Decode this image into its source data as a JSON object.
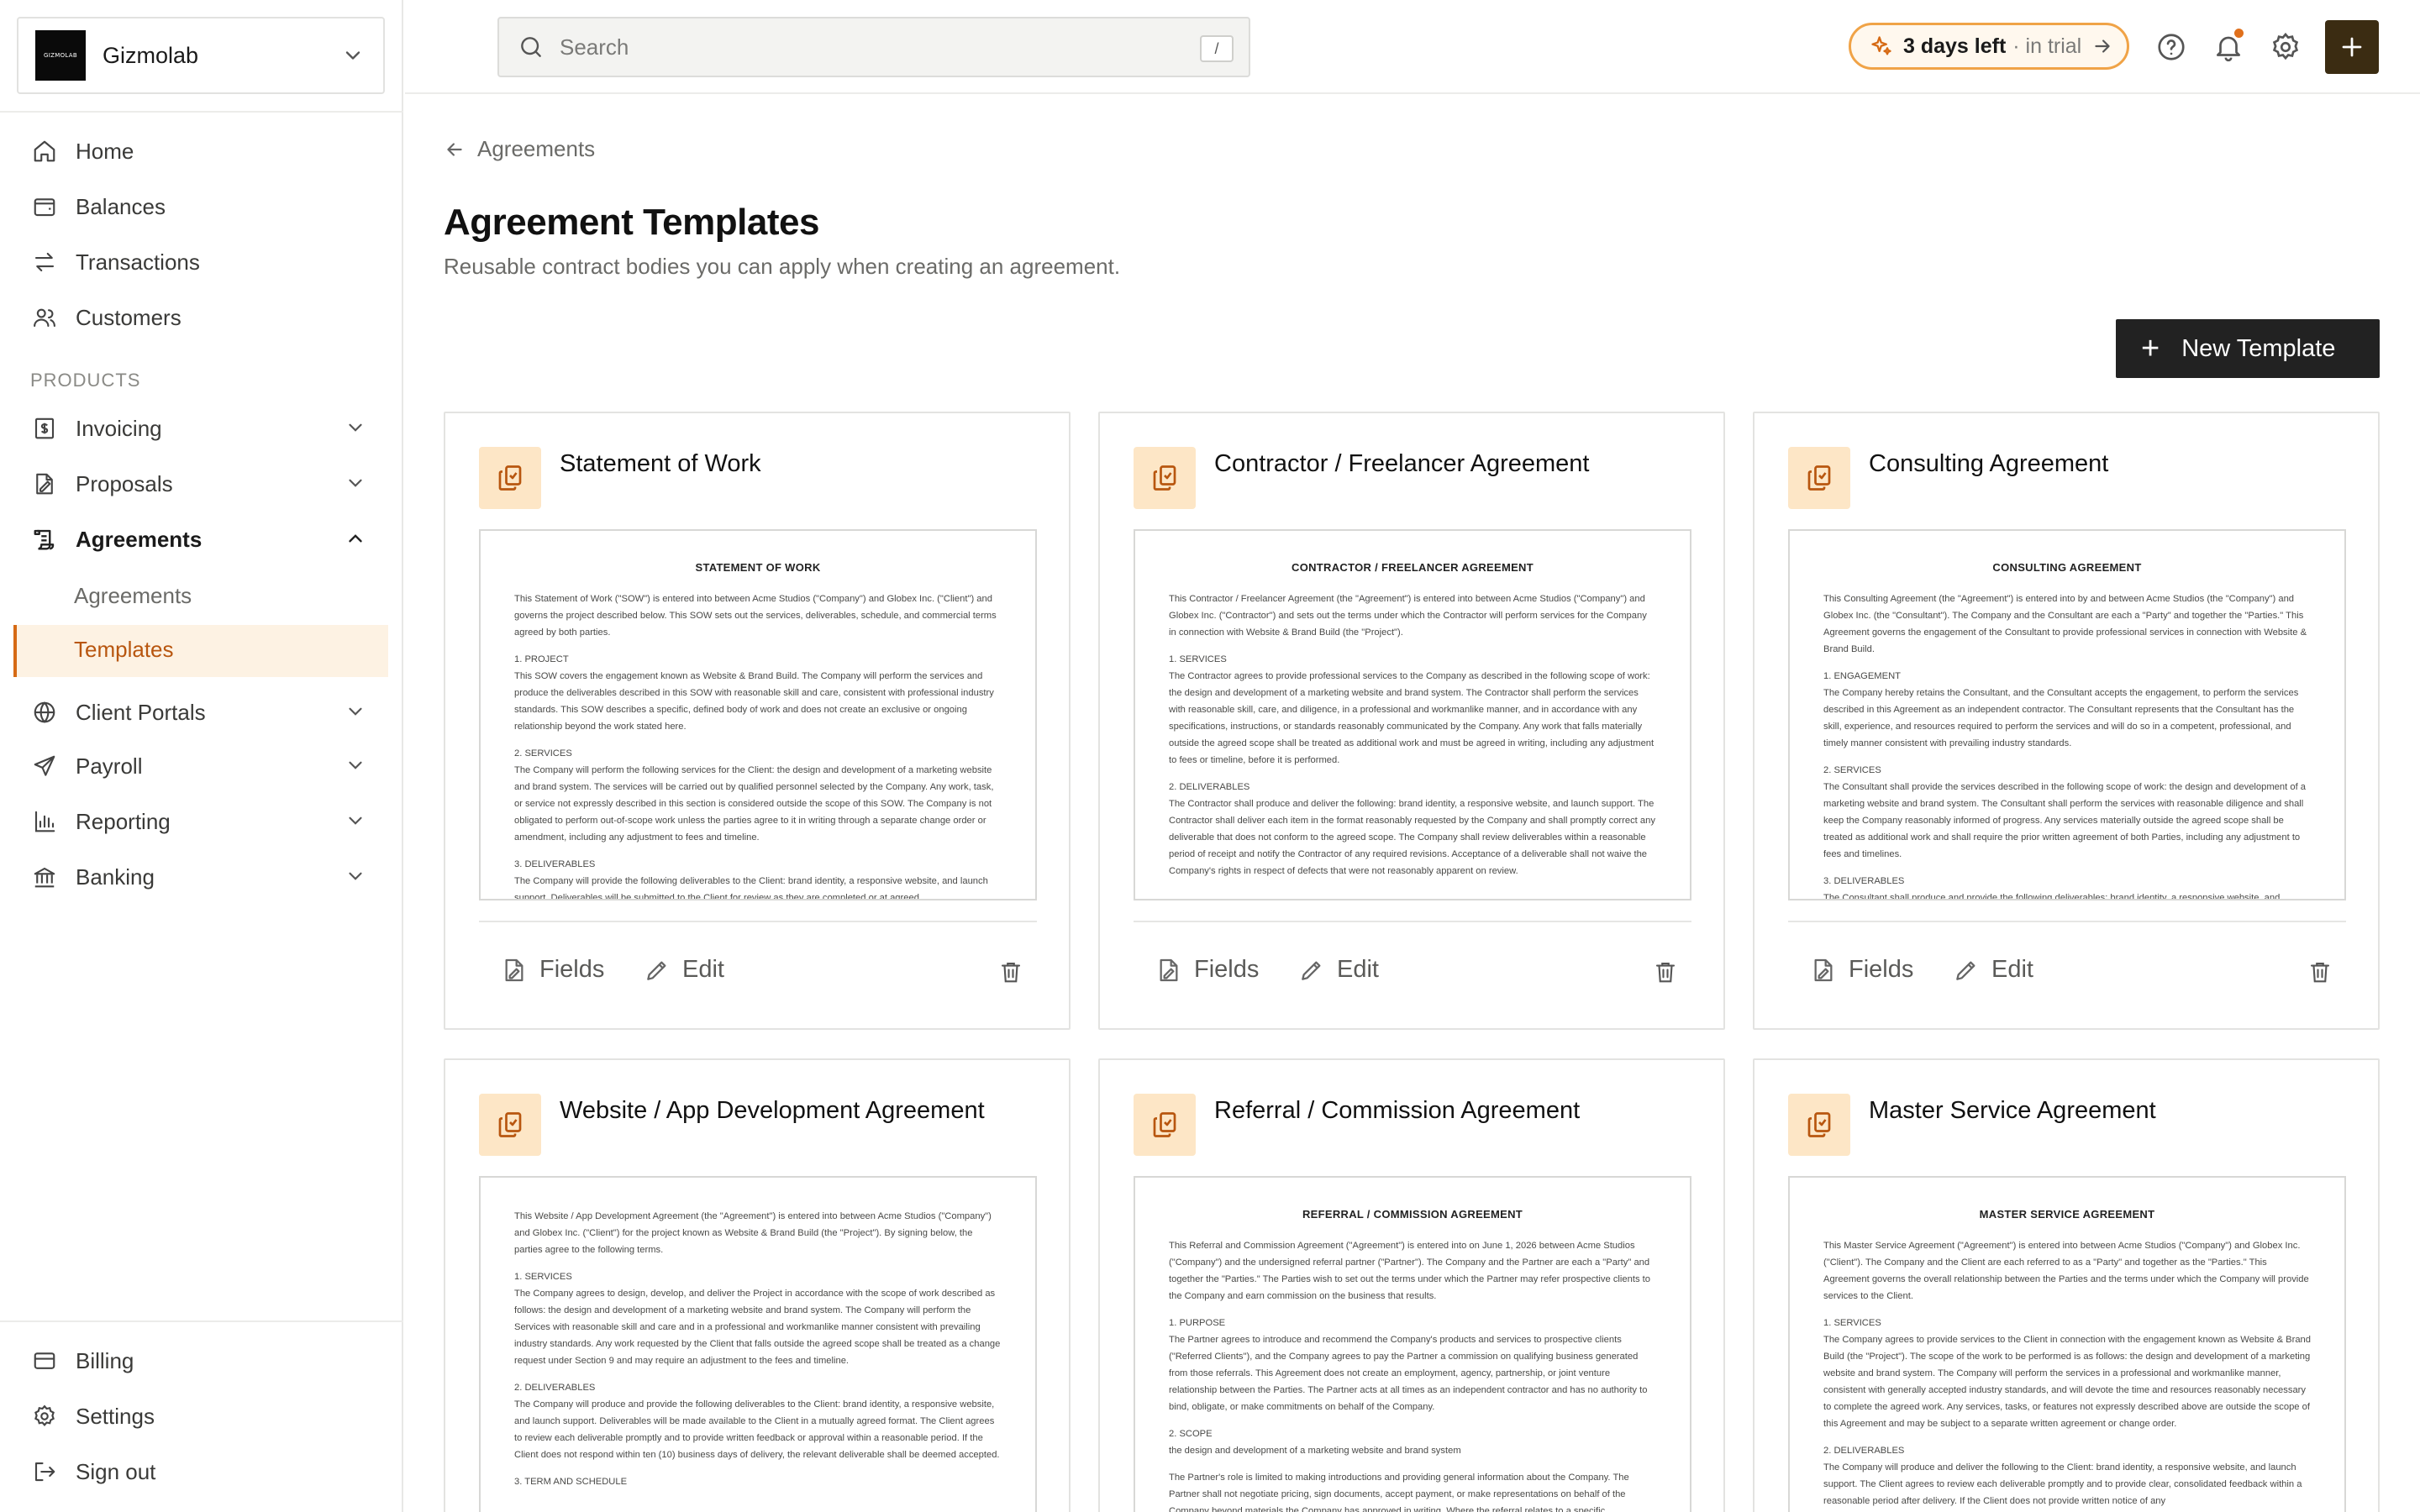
{
  "org": {
    "name": "Gizmolab",
    "logo_text": "GIZMOLAB"
  },
  "nav": {
    "primary": [
      {
        "label": "Home",
        "icon": "home-icon"
      },
      {
        "label": "Balances",
        "icon": "wallet-icon"
      },
      {
        "label": "Transactions",
        "icon": "arrows-exchange-icon"
      },
      {
        "label": "Customers",
        "icon": "users-icon"
      }
    ],
    "section_label": "PRODUCTS",
    "products": [
      {
        "label": "Invoicing",
        "icon": "invoice-icon"
      },
      {
        "label": "Proposals",
        "icon": "proposal-icon"
      },
      {
        "label": "Agreements",
        "icon": "agreement-icon"
      },
      {
        "label": "Client Portals",
        "icon": "globe-icon"
      },
      {
        "label": "Payroll",
        "icon": "send-icon"
      },
      {
        "label": "Reporting",
        "icon": "bar-chart-icon"
      },
      {
        "label": "Banking",
        "icon": "bank-icon"
      }
    ],
    "agreements_sub": [
      "Agreements",
      "Templates"
    ],
    "bottom": [
      {
        "label": "Billing",
        "icon": "credit-card-icon"
      },
      {
        "label": "Settings",
        "icon": "gear-icon"
      },
      {
        "label": "Sign out",
        "icon": "sign-out-icon"
      }
    ]
  },
  "topbar": {
    "search_placeholder": "Search",
    "search_shortcut": "/",
    "trial_days": "3 days left",
    "trial_suffix": "· in trial"
  },
  "page": {
    "back_label": "Agreements",
    "title": "Agreement Templates",
    "subtitle": "Reusable contract bodies you can apply when creating an agreement.",
    "new_button": "New Template"
  },
  "actions": {
    "fields": "Fields",
    "edit": "Edit"
  },
  "colors": {
    "accent": "#d66a14",
    "accent_bg": "#fdf2e3",
    "icon_bg": "#fde6c6",
    "dark_button": "#222222",
    "plus_button": "#3b2c12"
  },
  "templates": [
    {
      "title": "Statement of Work",
      "preview_heading": "STATEMENT OF WORK",
      "preview": [
        "This Statement of Work (\"SOW\") is entered into between Acme Studios (\"Company\") and Globex Inc. (\"Client\") and governs the project described below. This SOW sets out the services, deliverables, schedule, and commercial terms agreed by both parties.",
        "1. PROJECT",
        "This SOW covers the engagement known as Website & Brand Build. The Company will perform the services and produce the deliverables described in this SOW with reasonable skill and care, consistent with professional industry standards. This SOW describes a specific, defined body of work and does not create an exclusive or ongoing relationship beyond the work stated here.",
        "2. SERVICES",
        "The Company will perform the following services for the Client: the design and development of a marketing website and brand system. The services will be carried out by qualified personnel selected by the Company. Any work, task, or service not expressly described in this section is considered outside the scope of this SOW. The Company is not obligated to perform out-of-scope work unless the parties agree to it in writing through a separate change order or amendment, including any adjustment to fees and timeline.",
        "3. DELIVERABLES",
        "The Company will provide the following deliverables to the Client: brand identity, a responsive website, and launch support. Deliverables will be submitted to the Client for review as they are completed or at agreed"
      ]
    },
    {
      "title": "Contractor / Freelancer Agreement",
      "preview_heading": "CONTRACTOR / FREELANCER AGREEMENT",
      "preview": [
        "This Contractor / Freelancer Agreement (the \"Agreement\") is entered into between Acme Studios (\"Company\") and Globex Inc. (\"Contractor\") and sets out the terms under which the Contractor will perform services for the Company in connection with Website & Brand Build (the \"Project\").",
        "1. SERVICES",
        "The Contractor agrees to provide professional services to the Company as described in the following scope of work: the design and development of a marketing website and brand system. The Contractor shall perform the services with reasonable skill, care, and diligence, in a professional and workmanlike manner, and in accordance with any specifications, instructions, or standards reasonably communicated by the Company. Any work that falls materially outside the agreed scope shall be treated as additional work and must be agreed in writing, including any adjustment to fees or timeline, before it is performed.",
        "2. DELIVERABLES",
        "The Contractor shall produce and deliver the following: brand identity, a responsive website, and launch support. The Contractor shall deliver each item in the format reasonably requested by the Company and shall promptly correct any deliverable that does not conform to the agreed scope. The Company shall review deliverables within a reasonable period of receipt and notify the Contractor of any required revisions. Acceptance of a deliverable shall not waive the Company's rights in respect of defects that were not reasonably apparent on review."
      ]
    },
    {
      "title": "Consulting Agreement",
      "preview_heading": "CONSULTING AGREEMENT",
      "preview": [
        "This Consulting Agreement (the \"Agreement\") is entered into by and between Acme Studios (the \"Company\") and Globex Inc. (the \"Consultant\"). The Company and the Consultant are each a \"Party\" and together the \"Parties.\" This Agreement governs the engagement of the Consultant to provide professional services in connection with Website & Brand Build.",
        "1. ENGAGEMENT",
        "The Company hereby retains the Consultant, and the Consultant accepts the engagement, to perform the services described in this Agreement as an independent contractor. The Consultant represents that the Consultant has the skill, experience, and resources required to perform the services and will do so in a competent, professional, and timely manner consistent with prevailing industry standards.",
        "2. SERVICES",
        "The Consultant shall provide the services described in the following scope of work: the design and development of a marketing website and brand system. The Consultant shall perform the services with reasonable diligence and shall keep the Company reasonably informed of progress. Any services materially outside the agreed scope shall be treated as additional work and shall require the prior written agreement of both Parties, including any adjustment to fees and timelines.",
        "3. DELIVERABLES",
        "The Consultant shall produce and provide the following deliverables: brand identity, a responsive website, and"
      ]
    },
    {
      "title": "Website / App Development Agreement",
      "preview_heading": "",
      "preview": [
        "This Website / App Development Agreement (the \"Agreement\") is entered into between Acme Studios (\"Company\") and Globex Inc. (\"Client\") for the project known as Website & Brand Build (the \"Project\"). By signing below, the parties agree to the following terms.",
        "1. SERVICES",
        "The Company agrees to design, develop, and deliver the Project in accordance with the scope of work described as follows: the design and development of a marketing website and brand system. The Company will perform the Services with reasonable skill and care and in a professional and workmanlike manner consistent with prevailing industry standards. Any work requested by the Client that falls outside the agreed scope shall be treated as a change request under Section 9 and may require an adjustment to the fees and timeline.",
        "2. DELIVERABLES",
        "The Company will produce and provide the following deliverables to the Client: brand identity, a responsive website, and launch support. Deliverables will be made available to the Client in a mutually agreed format. The Client agrees to review each deliverable promptly and to provide written feedback or approval within a reasonable period. If the Client does not respond within ten (10) business days of delivery, the relevant deliverable shall be deemed accepted.",
        "3. TERM AND SCHEDULE"
      ]
    },
    {
      "title": "Referral / Commission Agreement",
      "preview_heading": "REFERRAL / COMMISSION AGREEMENT",
      "preview": [
        "This Referral and Commission Agreement (\"Agreement\") is entered into on June 1, 2026 between Acme Studios (\"Company\") and the undersigned referral partner (\"Partner\"). The Company and the Partner are each a \"Party\" and together the \"Parties.\" The Parties wish to set out the terms under which the Partner may refer prospective clients to the Company and earn commission on the business that results.",
        "1. PURPOSE",
        "The Partner agrees to introduce and recommend the Company's products and services to prospective clients (\"Referred Clients\"), and the Company agrees to pay the Partner a commission on qualifying business generated from those referrals. This Agreement does not create an employment, agency, partnership, or joint venture relationship between the Parties. The Partner acts at all times as an independent contractor and has no authority to bind, obligate, or make commitments on behalf of the Company.",
        "2. SCOPE",
        "the design and development of a marketing website and brand system",
        "The Partner's role is limited to making introductions and providing general information about the Company. The Partner shall not negotiate pricing, sign documents, accept payment, or make representations on behalf of the Company beyond materials the Company has approved in writing. Where the referral relates to a specific engagement, it may be identified as Website & Brand Build."
      ]
    },
    {
      "title": "Master Service Agreement",
      "preview_heading": "MASTER SERVICE AGREEMENT",
      "preview": [
        "This Master Service Agreement (\"Agreement\") is entered into between Acme Studios (\"Company\") and Globex Inc. (\"Client\"). The Company and the Client are each referred to as a \"Party\" and together as the \"Parties.\" This Agreement governs the overall relationship between the Parties and the terms under which the Company will provide services to the Client.",
        "1. SERVICES",
        "The Company agrees to provide services to the Client in connection with the engagement known as Website & Brand Build (the \"Project\"). The scope of the work to be performed is as follows: the design and development of a marketing website and brand system. The Company will perform the services in a professional and workmanlike manner, consistent with generally accepted industry standards, and will devote the time and resources reasonably necessary to complete the agreed work. Any services, tasks, or features not expressly described above are outside the scope of this Agreement and may be subject to a separate written agreement or change order.",
        "2. DELIVERABLES",
        "The Company will produce and deliver the following to the Client: brand identity, a responsive website, and launch support. The Client agrees to review each deliverable promptly and to provide clear, consolidated feedback within a reasonable period after delivery. If the Client does not provide written notice of any"
      ]
    }
  ]
}
